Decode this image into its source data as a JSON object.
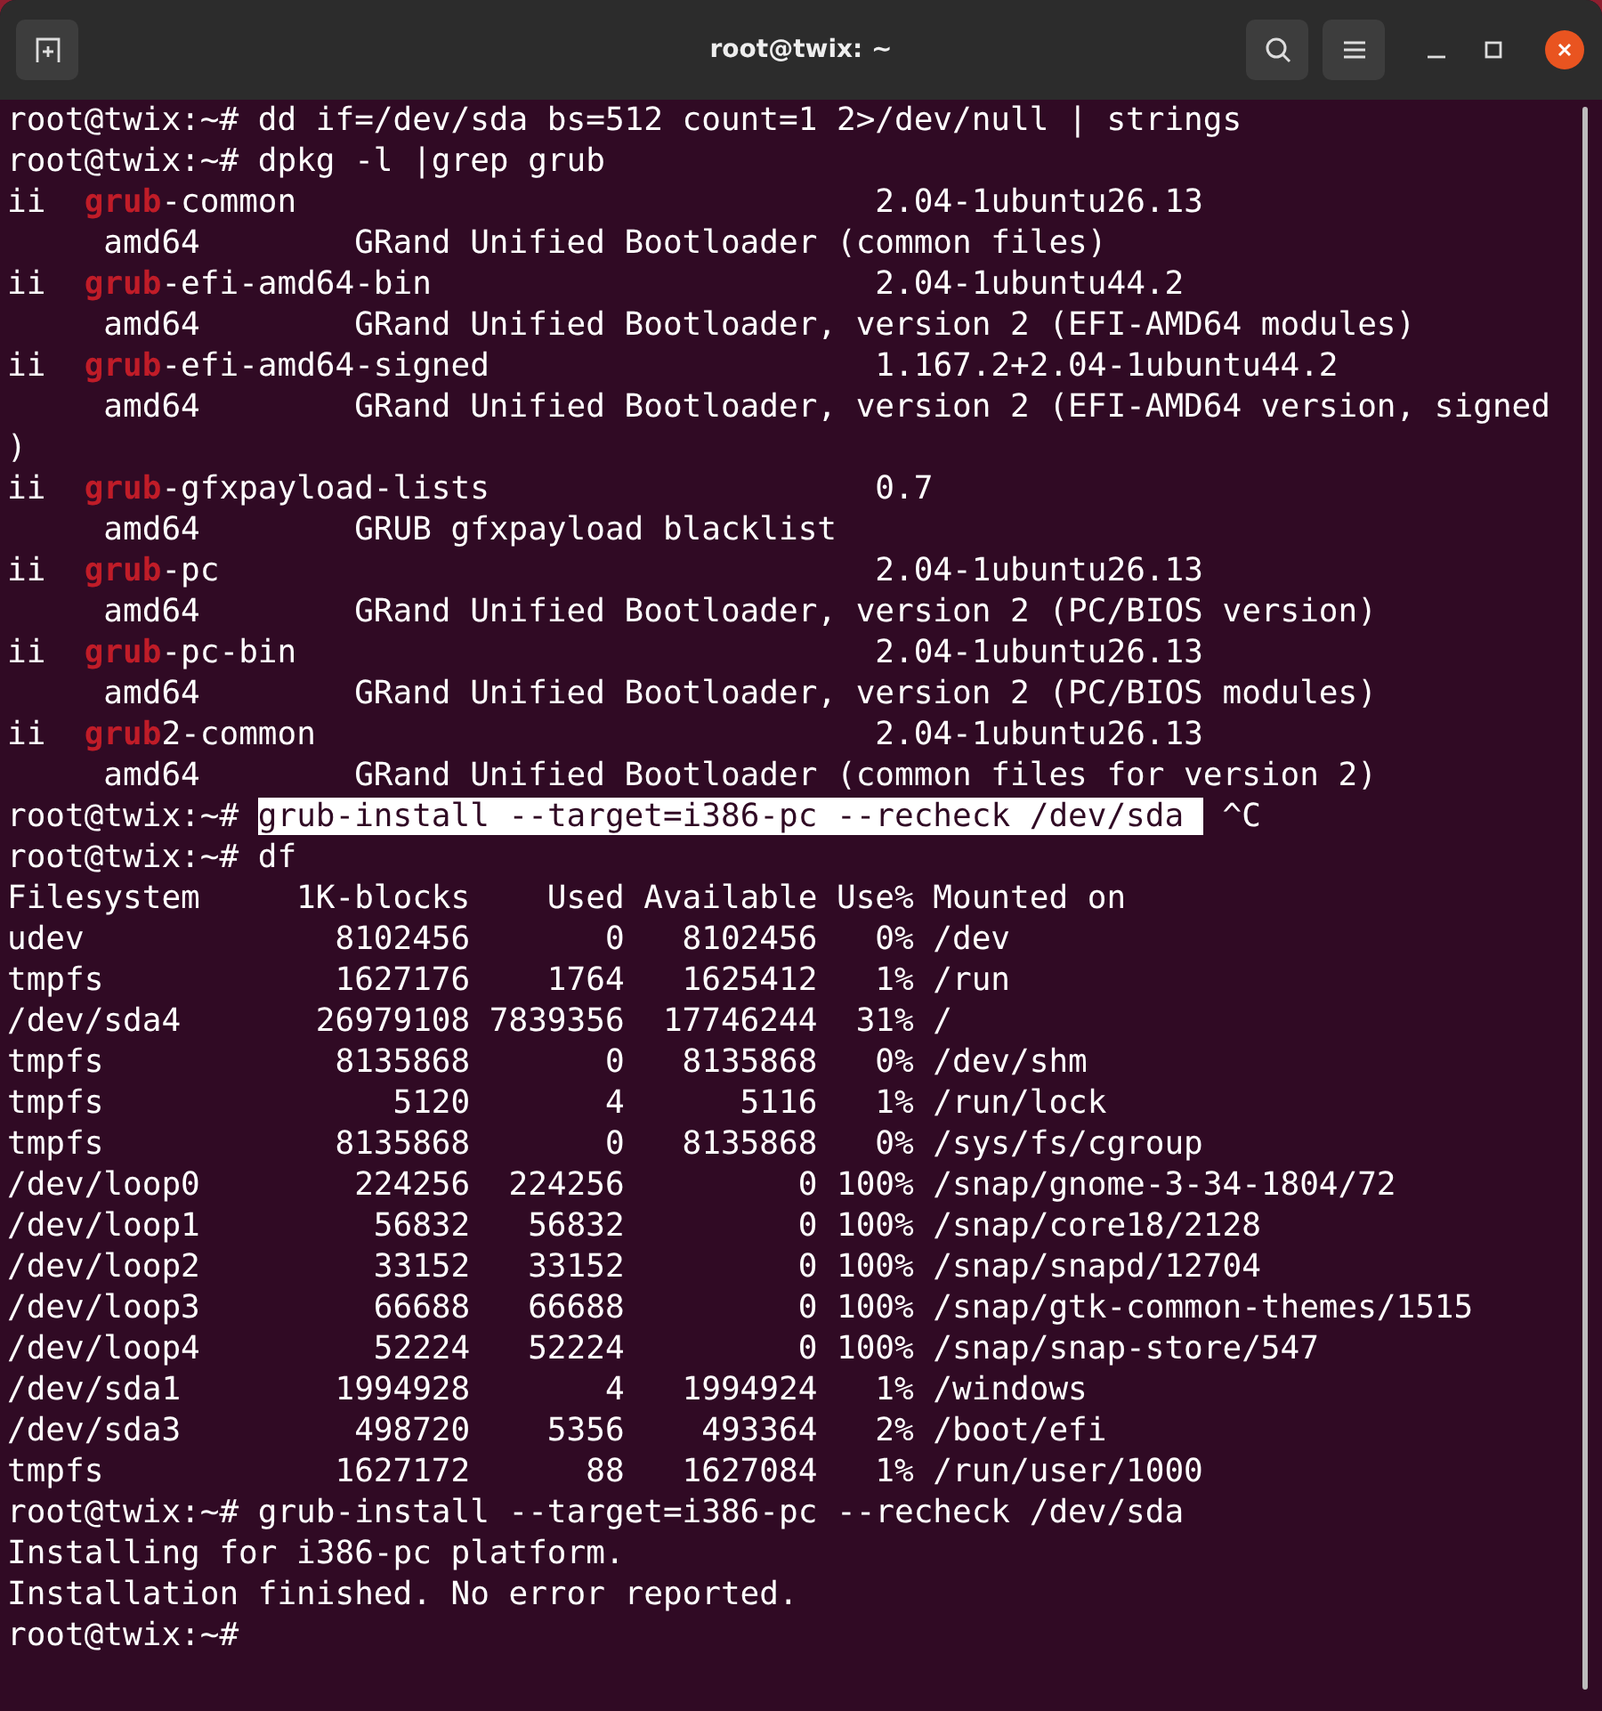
{
  "window": {
    "title": "root@twix: ~"
  },
  "terminal": {
    "lines": [
      {
        "segments": [
          {
            "kind": "plain",
            "text": "root@twix:~# dd if=/dev/sda bs=512 count=1 2>/dev/null | strings"
          }
        ]
      },
      {
        "segments": [
          {
            "kind": "plain",
            "text": "root@twix:~# dpkg -l |grep grub"
          }
        ]
      },
      {
        "segments": [
          {
            "kind": "plain",
            "text": "ii  "
          },
          {
            "kind": "match",
            "text": "grub"
          },
          {
            "kind": "plain",
            "text": "-common                              2.04-1ubuntu26.13"
          }
        ]
      },
      {
        "segments": [
          {
            "kind": "plain",
            "text": "     amd64        GRand Unified Bootloader (common files)"
          }
        ]
      },
      {
        "segments": [
          {
            "kind": "plain",
            "text": "ii  "
          },
          {
            "kind": "match",
            "text": "grub"
          },
          {
            "kind": "plain",
            "text": "-efi-amd64-bin                       2.04-1ubuntu44.2"
          }
        ]
      },
      {
        "segments": [
          {
            "kind": "plain",
            "text": "     amd64        GRand Unified Bootloader, version 2 (EFI-AMD64 modules)"
          }
        ]
      },
      {
        "segments": [
          {
            "kind": "plain",
            "text": "ii  "
          },
          {
            "kind": "match",
            "text": "grub"
          },
          {
            "kind": "plain",
            "text": "-efi-amd64-signed                    1.167.2+2.04-1ubuntu44.2"
          }
        ]
      },
      {
        "segments": [
          {
            "kind": "plain",
            "text": "     amd64        GRand Unified Bootloader, version 2 (EFI-AMD64 version, signed"
          }
        ]
      },
      {
        "segments": [
          {
            "kind": "plain",
            "text": ")"
          }
        ]
      },
      {
        "segments": [
          {
            "kind": "plain",
            "text": "ii  "
          },
          {
            "kind": "match",
            "text": "grub"
          },
          {
            "kind": "plain",
            "text": "-gfxpayload-lists                    0.7"
          }
        ]
      },
      {
        "segments": [
          {
            "kind": "plain",
            "text": "     amd64        GRUB gfxpayload blacklist"
          }
        ]
      },
      {
        "segments": [
          {
            "kind": "plain",
            "text": "ii  "
          },
          {
            "kind": "match",
            "text": "grub"
          },
          {
            "kind": "plain",
            "text": "-pc                                  2.04-1ubuntu26.13"
          }
        ]
      },
      {
        "segments": [
          {
            "kind": "plain",
            "text": "     amd64        GRand Unified Bootloader, version 2 (PC/BIOS version)"
          }
        ]
      },
      {
        "segments": [
          {
            "kind": "plain",
            "text": "ii  "
          },
          {
            "kind": "match",
            "text": "grub"
          },
          {
            "kind": "plain",
            "text": "-pc-bin                              2.04-1ubuntu26.13"
          }
        ]
      },
      {
        "segments": [
          {
            "kind": "plain",
            "text": "     amd64        GRand Unified Bootloader, version 2 (PC/BIOS modules)"
          }
        ]
      },
      {
        "segments": [
          {
            "kind": "plain",
            "text": "ii  "
          },
          {
            "kind": "match",
            "text": "grub"
          },
          {
            "kind": "plain",
            "text": "2-common                             2.04-1ubuntu26.13"
          }
        ]
      },
      {
        "segments": [
          {
            "kind": "plain",
            "text": "     amd64        GRand Unified Bootloader (common files for version 2)"
          }
        ]
      },
      {
        "segments": [
          {
            "kind": "plain",
            "text": "root@twix:~# "
          },
          {
            "kind": "selected",
            "text": "grub-install --target=i386-pc --recheck /dev/sda "
          },
          {
            "kind": "plain",
            "text": " ^C"
          }
        ]
      },
      {
        "segments": [
          {
            "kind": "plain",
            "text": "root@twix:~# df"
          }
        ]
      },
      {
        "segments": [
          {
            "kind": "plain",
            "text": "Filesystem     1K-blocks    Used Available Use% Mounted on"
          }
        ]
      },
      {
        "segments": [
          {
            "kind": "plain",
            "text": "udev             8102456       0   8102456   0% /dev"
          }
        ]
      },
      {
        "segments": [
          {
            "kind": "plain",
            "text": "tmpfs            1627176    1764   1625412   1% /run"
          }
        ]
      },
      {
        "segments": [
          {
            "kind": "plain",
            "text": "/dev/sda4       26979108 7839356  17746244  31% /"
          }
        ]
      },
      {
        "segments": [
          {
            "kind": "plain",
            "text": "tmpfs            8135868       0   8135868   0% /dev/shm"
          }
        ]
      },
      {
        "segments": [
          {
            "kind": "plain",
            "text": "tmpfs               5120       4      5116   1% /run/lock"
          }
        ]
      },
      {
        "segments": [
          {
            "kind": "plain",
            "text": "tmpfs            8135868       0   8135868   0% /sys/fs/cgroup"
          }
        ]
      },
      {
        "segments": [
          {
            "kind": "plain",
            "text": "/dev/loop0        224256  224256         0 100% /snap/gnome-3-34-1804/72"
          }
        ]
      },
      {
        "segments": [
          {
            "kind": "plain",
            "text": "/dev/loop1         56832   56832         0 100% /snap/core18/2128"
          }
        ]
      },
      {
        "segments": [
          {
            "kind": "plain",
            "text": "/dev/loop2         33152   33152         0 100% /snap/snapd/12704"
          }
        ]
      },
      {
        "segments": [
          {
            "kind": "plain",
            "text": "/dev/loop3         66688   66688         0 100% /snap/gtk-common-themes/1515"
          }
        ]
      },
      {
        "segments": [
          {
            "kind": "plain",
            "text": "/dev/loop4         52224   52224         0 100% /snap/snap-store/547"
          }
        ]
      },
      {
        "segments": [
          {
            "kind": "plain",
            "text": "/dev/sda1        1994928       4   1994924   1% /windows"
          }
        ]
      },
      {
        "segments": [
          {
            "kind": "plain",
            "text": "/dev/sda3         498720    5356    493364   2% /boot/efi"
          }
        ]
      },
      {
        "segments": [
          {
            "kind": "plain",
            "text": "tmpfs            1627172      88   1627084   1% /run/user/1000"
          }
        ]
      },
      {
        "segments": [
          {
            "kind": "plain",
            "text": "root@twix:~# grub-install --target=i386-pc --recheck /dev/sda"
          }
        ]
      },
      {
        "segments": [
          {
            "kind": "plain",
            "text": "Installing for i386-pc platform."
          }
        ]
      },
      {
        "segments": [
          {
            "kind": "plain",
            "text": "Installation finished. No error reported."
          }
        ]
      },
      {
        "segments": [
          {
            "kind": "plain",
            "text": "root@twix:~# "
          }
        ]
      }
    ]
  }
}
